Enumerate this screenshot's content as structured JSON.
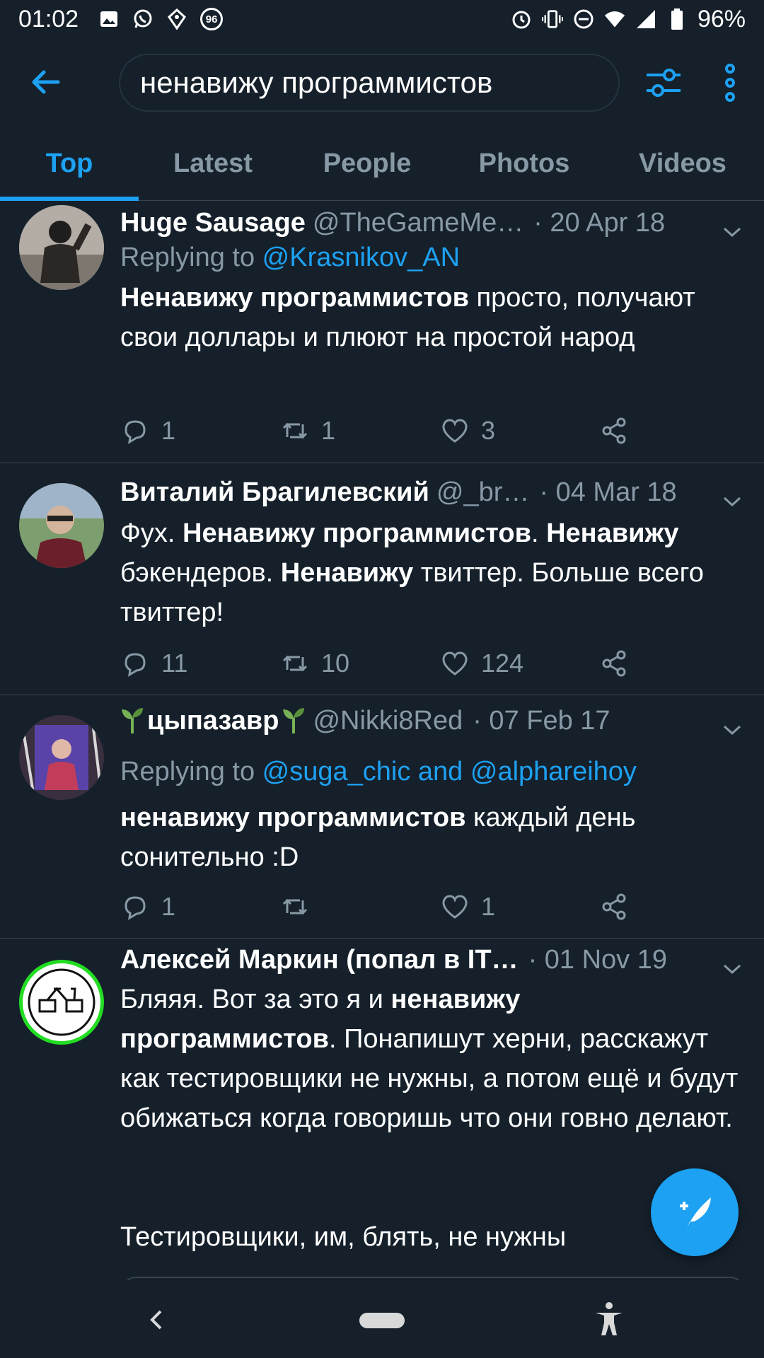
{
  "status_bar": {
    "time": "01:02",
    "badge": "96",
    "battery": "96%"
  },
  "search": {
    "query": "ненавижу программистов"
  },
  "tabs": [
    {
      "label": "Top",
      "active": true
    },
    {
      "label": "Latest",
      "active": false
    },
    {
      "label": "People",
      "active": false
    },
    {
      "label": "Photos",
      "active": false
    },
    {
      "label": "Videos",
      "active": false
    }
  ],
  "tweets": [
    {
      "name": "Huge Sausage",
      "handle": "@TheGameMe…",
      "date": "· 20 Apr 18",
      "reply_prefix": "Replying to ",
      "reply_to": "@Krasnikov_AN",
      "body_bold_1": "Ненавижу программистов",
      "body_rest_1": " просто, получают свои доллары и плюют на простой народ",
      "replies": "1",
      "retweets": "1",
      "likes": "3"
    },
    {
      "name": "Виталий Брагилевский",
      "handle": "@_br…",
      "date": "· 04 Mar 18",
      "body_t1": "Фух. ",
      "body_b1": "Ненавижу программистов",
      "body_t2": ". ",
      "body_b2": "Ненавижу",
      "body_t3": " бэкендеров. ",
      "body_b3": "Ненавижу",
      "body_t4": " твиттер. Больше всего твиттер!",
      "replies": "11",
      "retweets": "10",
      "likes": "124"
    },
    {
      "name": "цыпазавр",
      "handle": "@Nikki8Red",
      "date": "· 07 Feb 17",
      "reply_prefix": "Replying to ",
      "reply_to": "@suga_chic and @alphareihoy",
      "body_bold_1": "ненавижу программистов",
      "body_rest_1": " каждый день сонительно :D",
      "replies": "1",
      "retweets": "",
      "likes": "1"
    },
    {
      "name": "Алексей Маркин (попал в IT…",
      "date": "· 01 Nov 19",
      "body_t1": "Бляяя. Вот за это я и ",
      "body_b1": "ненавижу программистов",
      "body_t2": ". Понапишут херни, расскажут как тестировщики не нужны, а потом ещё и будут обижаться когда говоришь что они говно делают.",
      "body_p2": "Тестировщики, им, блять, не нужны"
    }
  ],
  "colors": {
    "background": "#15202b",
    "accent": "#1da1f2",
    "muted": "#8899a6",
    "divider": "#38444d"
  }
}
